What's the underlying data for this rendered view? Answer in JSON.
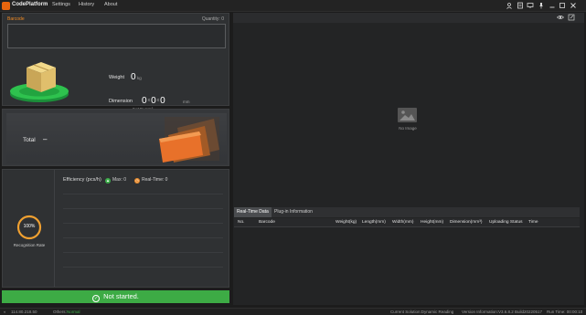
{
  "app": {
    "title": "CodePlatform"
  },
  "menu": {
    "settings": "Settings",
    "history": "History",
    "about": "About"
  },
  "barcode_panel": {
    "label": "Barcode",
    "quantity": "Quantity: 0",
    "barcode_value": ""
  },
  "measure": {
    "weight_label": "Weight",
    "weight_value": "0",
    "weight_unit": "kg",
    "dimension_label": "Dimension",
    "dim_length": "0",
    "dim_width": "0",
    "dim_height": "0",
    "dim_separator": "x",
    "dim_unit": "mm",
    "volume": "0×10⁶ mm³"
  },
  "total": {
    "label": "Total",
    "value": "–"
  },
  "stats": {
    "efficiency_label": "Efficiency (pcs/h)",
    "max_label": "Max: 0",
    "realtime_label": "Real-Time: 0",
    "recognition_rate": "100%",
    "recognition_fraction": 1.0,
    "recognition_label": "Recognition Rate"
  },
  "status_button": {
    "label": "Not started."
  },
  "image_area": {
    "placeholder": "No Image"
  },
  "tabs": {
    "realtime": "Real-Time Data",
    "plugin": "Plug-in Information"
  },
  "table": {
    "columns": [
      "No.",
      "Barcode",
      "Weight(kg)",
      "Length(mm)",
      "Width(mm)",
      "Height(mm)",
      "Dimension(mm³)",
      "Uploading Status",
      "Time"
    ]
  },
  "footer": {
    "ip": "114.80.218.50",
    "others_label": "Others:",
    "others_value": "Normal",
    "solution": "Current Solution:Dynamic Reading",
    "version": "Version Information:V3.6.8.2 Build20220517",
    "runtime": "Run Time: 00:00:10"
  },
  "colors": {
    "accent": "#e8650e",
    "success": "#3dab45",
    "background": "#1c1c1c",
    "panel": "#2f3133"
  },
  "icons": {
    "titlebar": [
      "user-icon",
      "document-icon",
      "monitor-icon",
      "pin-icon",
      "minimize-icon",
      "maximize-icon",
      "close-icon"
    ],
    "image_toolbar": [
      "eye-icon",
      "export-icon"
    ]
  }
}
